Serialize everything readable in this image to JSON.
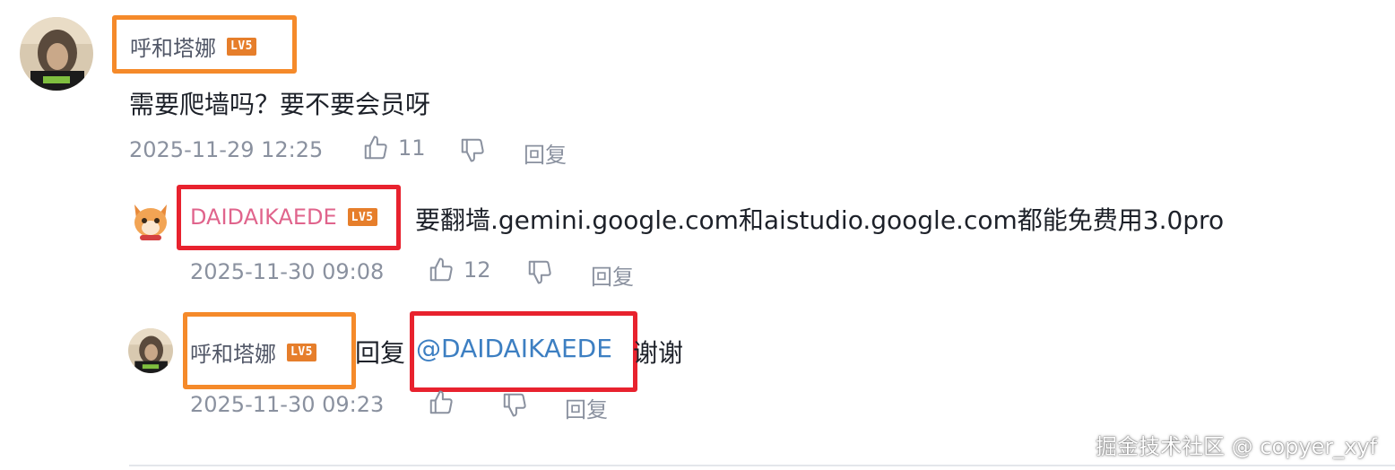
{
  "comment": {
    "username": "呼和塔娜",
    "level": "LV5",
    "text": "需要爬墙吗？要不要会员呀",
    "time": "2025-11-29 12:25",
    "likes": "11",
    "reply_label": "回复"
  },
  "replies": [
    {
      "username": "DAIDAIKAEDE",
      "level": "LV5",
      "text": "要翻墙.gemini.google.com和aistudio.google.com都能免费用3.0pro",
      "time": "2025-11-30 09:08",
      "likes": "12",
      "reply_label": "回复"
    },
    {
      "username": "呼和塔娜",
      "level": "LV5",
      "reply_word": "回复",
      "mention": "@DAIDAIKAEDE",
      "text": "谢谢",
      "time": "2025-11-30 09:23",
      "reply_label": "回复"
    }
  ],
  "watermark": "掘金技术社区 @ copyer_xyf",
  "colors": {
    "highlight_orange": "#f58a2a",
    "highlight_red": "#e8222e",
    "level_badge": "#e67e2b",
    "mention": "#3d7fc2",
    "pink_username": "#e0648c"
  },
  "icons": [
    "like-icon",
    "dislike-icon"
  ]
}
